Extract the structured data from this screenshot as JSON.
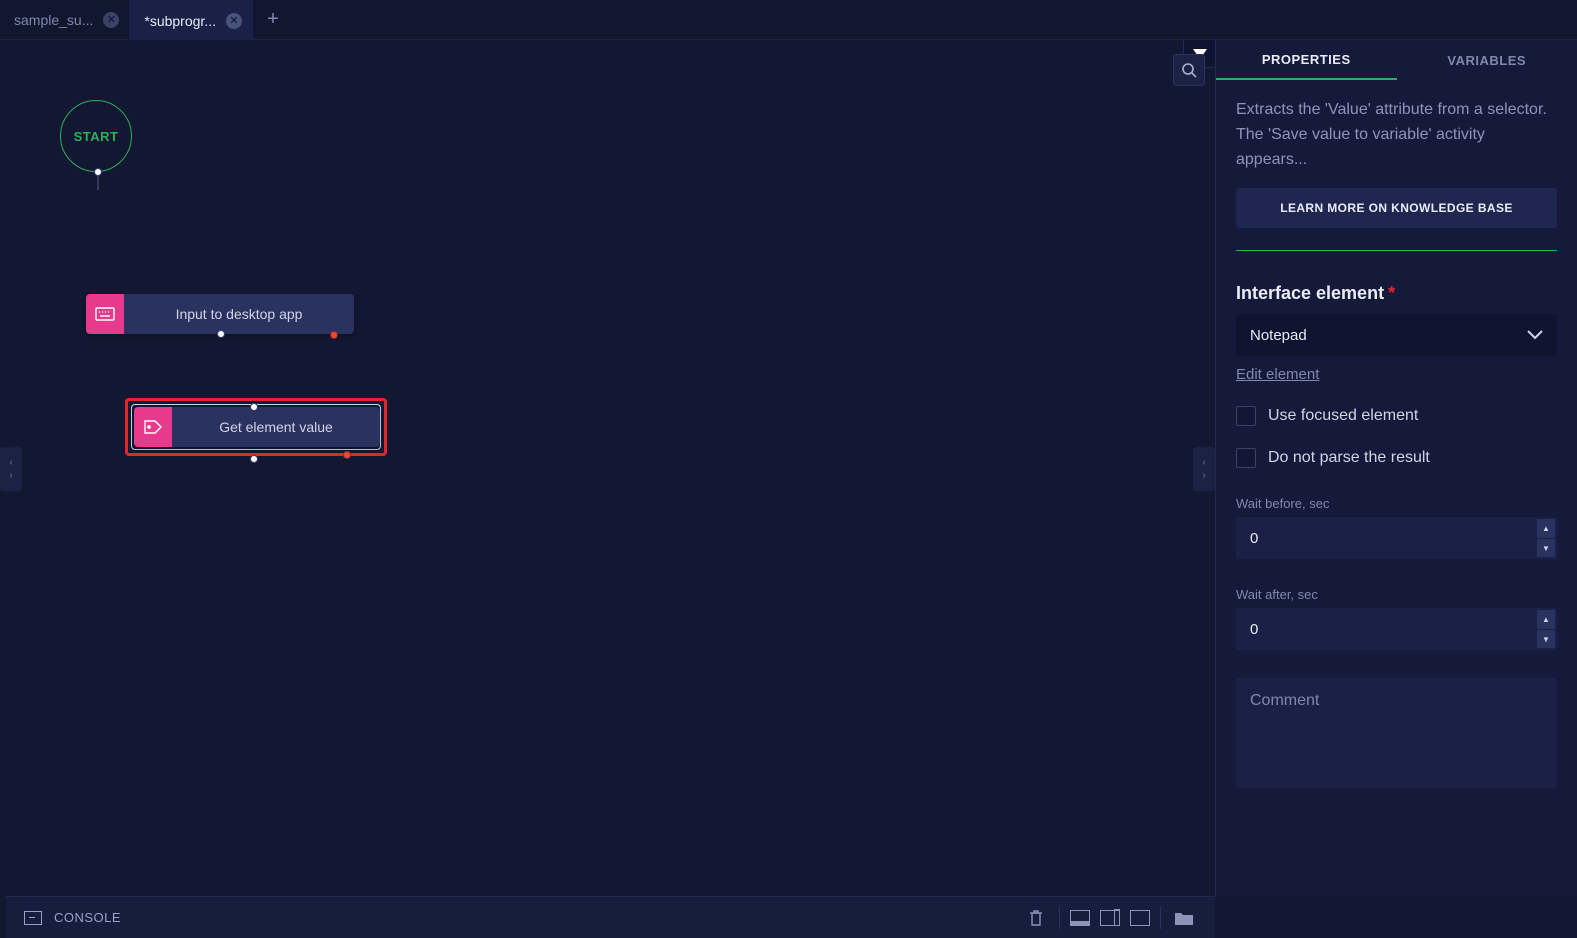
{
  "tabs": [
    {
      "label": "sample_su..."
    },
    {
      "label": "*subprogr..."
    }
  ],
  "canvas": {
    "start_label": "START",
    "node1_label": "Input to desktop app",
    "node2_label": "Get element value"
  },
  "right_panel": {
    "tab_properties": "Properties",
    "tab_variables": "Variables",
    "description": "Extracts the 'Value' attribute from a selector. The 'Save value to variable' activity appears...",
    "learn_more": "LEARN MORE ON KNOWLEDGE BASE",
    "interface_label": "Interface element",
    "interface_value": "Notepad",
    "edit_link": "Edit element",
    "use_focused": "Use focused element",
    "do_not_parse": "Do not parse the result",
    "wait_before_label": "Wait before, sec",
    "wait_before_value": "0",
    "wait_after_label": "Wait after, sec",
    "wait_after_value": "0",
    "comment_placeholder": "Comment"
  },
  "console": {
    "label": "CONSOLE"
  }
}
